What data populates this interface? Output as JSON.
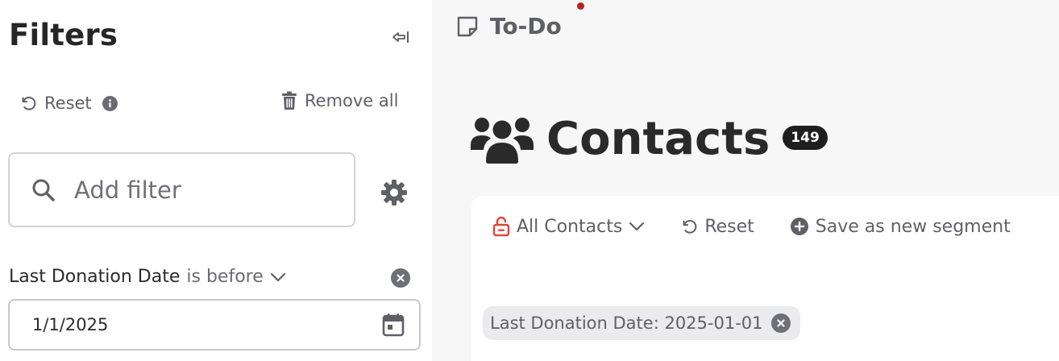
{
  "filters_panel": {
    "title": "Filters",
    "reset_label": "Reset",
    "remove_all_label": "Remove all",
    "add_filter_placeholder": "Add filter",
    "condition": {
      "field": "Last Donation Date",
      "operator": "is before",
      "value": "1/1/2025"
    }
  },
  "todo": {
    "label": "To-Do"
  },
  "contacts": {
    "title": "Contacts",
    "count": "149"
  },
  "toolbar": {
    "segment_label": "All Contacts",
    "reset_label": "Reset",
    "save_segment_label": "Save as new segment"
  },
  "active_filter_chip": {
    "label": "Last Donation Date: 2025-01-01"
  },
  "colors": {
    "accent_red": "#e0443a",
    "notification_dot": "#b3261e",
    "badge_bg": "#1f1f1f",
    "muted_text": "#5f5f66"
  }
}
